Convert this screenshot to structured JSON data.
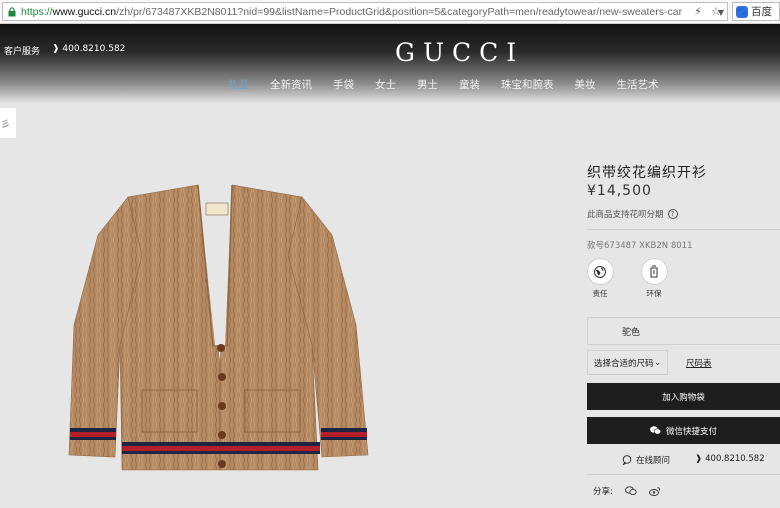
{
  "browser": {
    "url_scheme": "https://",
    "url_domain": "www.gucci.cn",
    "url_path": "/zh/pr/673487XKB2N8011?nid=99&listName=ProductGrid&position=5&categoryPath=men/readytowear/new-sweaters-car",
    "search_engine_label": "百度"
  },
  "header": {
    "customer_service": "客户服务",
    "phone": "400.8210.582",
    "logo": "GUCCI",
    "nav": [
      {
        "label": "礼品",
        "active": true
      },
      {
        "label": "全新资讯"
      },
      {
        "label": "手袋"
      },
      {
        "label": "女士"
      },
      {
        "label": "男士"
      },
      {
        "label": "童装"
      },
      {
        "label": "珠宝和腕表"
      },
      {
        "label": "美妆"
      },
      {
        "label": "生活艺术"
      }
    ]
  },
  "side_tab": "彡",
  "product": {
    "title": "织带绞花编织开衫",
    "price": "¥14,500",
    "installment_note": "此商品支持花呗分期",
    "sku": "款号673487 XKB2N 8011",
    "badges": [
      {
        "label": "责任",
        "icon": "globe-icon"
      },
      {
        "label": "环保",
        "icon": "recycle-icon"
      }
    ],
    "color": "驼色",
    "size_placeholder": "选择合适的尺码",
    "size_chart_link": "尺码表",
    "add_to_bag": "加入购物袋",
    "wechat_pay": "微信快捷支付",
    "online_consult": "在线顾问",
    "phone": "400.8210.582",
    "share_label": "分享:"
  },
  "colors": {
    "nav_active": "#6aa5c9",
    "button_bg": "#1e1e1e",
    "cardigan": "#b58a62",
    "stripe_red": "#b3202a",
    "stripe_navy": "#1c2544"
  }
}
